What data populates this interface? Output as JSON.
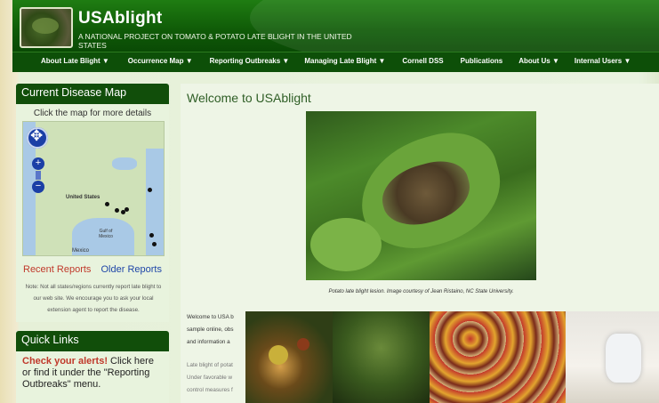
{
  "header": {
    "site_title": "USAblight",
    "tagline": "A National Project on Tomato & Potato Late Blight in the United States"
  },
  "nav": {
    "items": [
      "About Late Blight ▼",
      "Occurrence Map ▼",
      "Reporting Outbreaks ▼",
      "Managing Late Blight ▼",
      "Cornell DSS",
      "Publications",
      "About Us ▼",
      "Internal Users ▼"
    ]
  },
  "sidebar": {
    "map_box": {
      "title": "Current Disease Map",
      "caption": "Click the map for more details",
      "map_labels": {
        "us": "United States",
        "mexico": "Mexico",
        "gulf": "Gulf of Mexico"
      },
      "recent_reports": "Recent Reports",
      "older_reports": "Older Reports",
      "note": "Note: Not all states/regions currently report late blight to our web site. We encourage you to ask your local extension agent to report the disease."
    },
    "quick_links": {
      "title": "Quick Links",
      "alert_label": "Check your alerts!",
      "alert_text": " Click here or find it under the \"Reporting Outbreaks\" menu."
    }
  },
  "main": {
    "title": "Welcome to USAblight",
    "hero_caption": "Potato late blight lesion.  Image courtesy of Jean Ristaino, NC State University.",
    "body_lines": [
      "Welcome to USA b",
      "sample online, obs",
      "and  information a",
      "Late blight of potat",
      "Under favorable w",
      "control measures f"
    ]
  }
}
